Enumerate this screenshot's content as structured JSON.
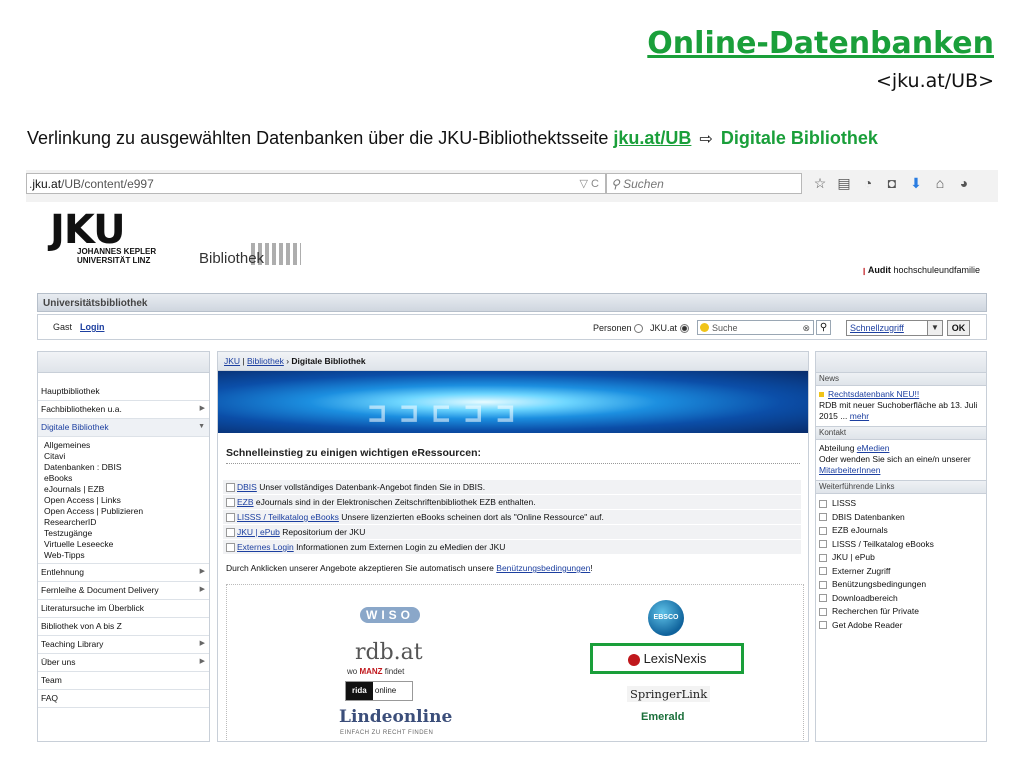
{
  "slide": {
    "title": "Online-Datenbanken",
    "subtitle": "<jku.at/UB>",
    "intro_text": "Verlinkung zu ausgewählten Datenbanken über die JKU-Bibliothektsseite",
    "intro_link": "jku.at/UB",
    "intro_arrow": "⇨",
    "intro_target": "Digitale Bibliothek"
  },
  "browser": {
    "url_host": "jku.at",
    "url_path": "/UB/content/e997",
    "url_prefix": ".",
    "search_placeholder": "Suchen",
    "url_icons": "▽  C"
  },
  "header": {
    "logo_text": "JKU",
    "logo_sub1": "JOHANNES KEPLER",
    "logo_sub2": "UNIVERSITÄT LINZ",
    "bibliothek": "Bibliothek",
    "audit_brand": "Audit",
    "audit_text": "hochschuleundfamilie"
  },
  "ub_bar": {
    "title": "Universitätsbibliothek"
  },
  "login_bar": {
    "gast": "Gast",
    "login": "Login",
    "personen": "Personen",
    "jku": "JKU.at",
    "search_placeholder": "Suche",
    "quick_access": "Schnellzugriff",
    "ok": "OK"
  },
  "left_nav": {
    "items_top": [
      {
        "label": "Hauptbibliothek"
      },
      {
        "label": "Fachbibliotheken u.a."
      },
      {
        "label": "Digitale Bibliothek"
      }
    ],
    "sub_items": [
      "Allgemeines",
      "Citavi",
      "Datenbanken : DBIS",
      "eBooks",
      "eJournals | EZB",
      "Open Access | Links",
      "Open Access | Publizieren",
      "ResearcherID",
      "Testzugänge",
      "Virtuelle Leseecke",
      "Web-Tipps"
    ],
    "items_bottom": [
      {
        "label": "Entlehnung"
      },
      {
        "label": "Fernleihe & Document Delivery"
      },
      {
        "label": "Literatursuche im Überblick"
      },
      {
        "label": "Bibliothek von A bis Z"
      },
      {
        "label": "Teaching Library"
      },
      {
        "label": "Über uns"
      },
      {
        "label": "Team"
      },
      {
        "label": "FAQ"
      }
    ]
  },
  "middle": {
    "crumb_1": "JKU",
    "crumb_sep": " | ",
    "crumb_2": "Bibliothek",
    "crumb_arrow": " › ",
    "crumb_current": "Digitale Bibliothek",
    "banner_glyphs": "⊐⊐⊏⊐⊐",
    "section_title": "Schnelleinstieg zu einigen wichtigen eRessourcen:",
    "resources": [
      {
        "link": "DBIS",
        "text": " Unser vollständiges Datenbank-Angebot finden Sie in DBIS."
      },
      {
        "link": "EZB",
        "text": " eJournals sind in der Elektronischen Zeitschriftenbibliothek EZB enthalten."
      },
      {
        "link": "LISSS / Teilkatalog eBooks",
        "text": " Unsere lizenzierten eBooks scheinen dort als \"Online Ressource\" auf."
      },
      {
        "link": "JKU | ePub",
        "text": " Repositorium der JKU"
      },
      {
        "link": "Externes Login",
        "text": " Informationen zum Externen Login zu eMedien der JKU"
      }
    ],
    "accept_text": "Durch Anklicken unserer Angebote akzeptieren Sie automatisch unsere ",
    "accept_link": "Benützungsbedingungen",
    "accept_end": "!"
  },
  "logos": {
    "wiso": "WISO",
    "rdb": "rdb.at",
    "rdb_sub_pre": "wo ",
    "rdb_sub_brand": "MANZ",
    "rdb_sub_post": " findet",
    "rida": "rida",
    "rida_online": "online",
    "linde": "Lindeonline",
    "linde_sub": "EINFACH ZU RECHT FINDEN",
    "ebsco": "EBSCO",
    "lexis": "LexisNexis",
    "springer": "SpringerLink",
    "emerald": "Emerald"
  },
  "right": {
    "news_head": "News",
    "news_link": "Rechtsdatenbank NEU!!",
    "news_text": "RDB mit neuer Suchoberfläche ab 13. Juli 2015 ...",
    "news_more": "mehr",
    "kontakt_head": "Kontakt",
    "kontakt_pre": "Abteilung ",
    "kontakt_link": "eMedien",
    "kontakt_text": "Oder wenden Sie sich an eine/n unserer ",
    "kontakt_link2": "MitarbeiterInnen",
    "links_head": "Weiterführende Links",
    "links": [
      "LISSS",
      "DBIS Datenbanken",
      "EZB eJournals",
      "LISSS / Teilkatalog eBooks",
      "JKU | ePub",
      "Externer Zugriff",
      "Benützungsbedingungen",
      "Downloadbereich",
      "Recherchen für Private",
      "Get Adobe Reader"
    ]
  }
}
